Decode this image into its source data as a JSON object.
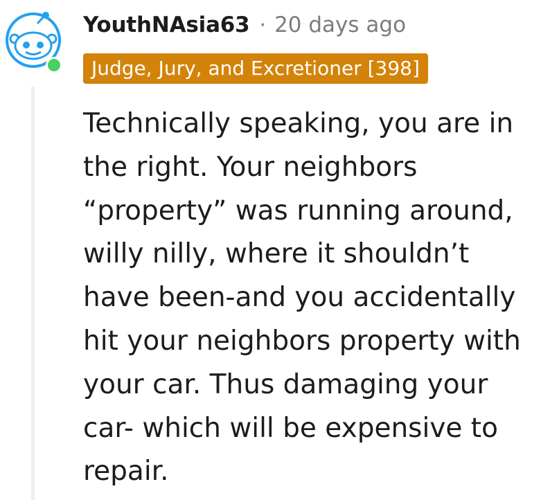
{
  "comment": {
    "author": "YouthNAsia63",
    "separator": "·",
    "timestamp": "20 days ago",
    "flair": "Judge, Jury, and Excretioner [398]",
    "body_lines": [
      "Technically speaking, you are in",
      "the right. Your neighbors",
      "“property” was running around,",
      "willy nilly, where it shouldn’t",
      "have been-and you accidentally",
      "hit your neighbors property with",
      "your car. Thus damaging your",
      "car- which will be expensive to",
      "repair."
    ]
  },
  "colors": {
    "flair_background": "#d4830a",
    "online_indicator": "#46d160",
    "avatar_background": "#0dd3bb",
    "thread_line": "#edeff1",
    "muted_text": "#7c7c7c"
  },
  "icons": {
    "avatar": "snoo-avatar-icon",
    "online_status": "online-dot-icon"
  }
}
